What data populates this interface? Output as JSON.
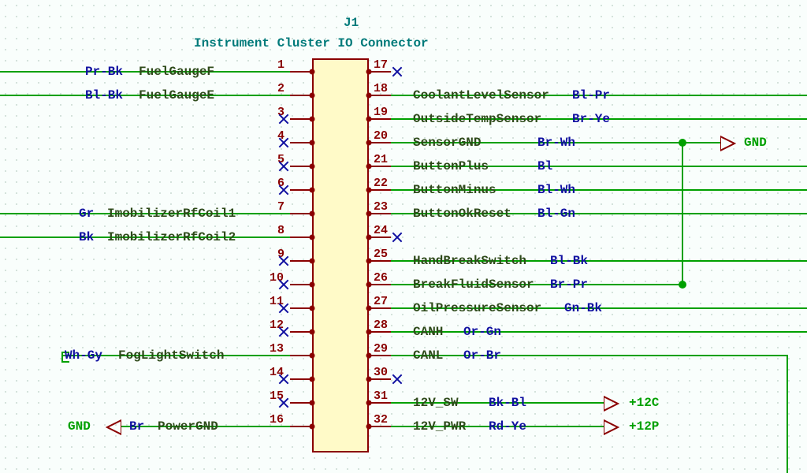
{
  "refdes": "J1",
  "title": "Instrument Cluster IO Connector",
  "power_labels": {
    "gnd_right": "GND",
    "gnd_left": "GND",
    "p12c": "+12C",
    "p12p": "+12P"
  },
  "left_pins": [
    {
      "num": "1",
      "net": "FuelGaugeF",
      "color": "Pr-Bk",
      "nc": false
    },
    {
      "num": "2",
      "net": "FuelGaugeE",
      "color": "Bl-Bk",
      "nc": false
    },
    {
      "num": "3",
      "net": "",
      "color": "",
      "nc": true
    },
    {
      "num": "4",
      "net": "",
      "color": "",
      "nc": true
    },
    {
      "num": "5",
      "net": "",
      "color": "",
      "nc": true
    },
    {
      "num": "6",
      "net": "",
      "color": "",
      "nc": true
    },
    {
      "num": "7",
      "net": "ImobilizerRfCoil1",
      "color": "Gr",
      "nc": false
    },
    {
      "num": "8",
      "net": "ImobilizerRfCoil2",
      "color": "Bk",
      "nc": false
    },
    {
      "num": "9",
      "net": "",
      "color": "",
      "nc": true
    },
    {
      "num": "10",
      "net": "",
      "color": "",
      "nc": true
    },
    {
      "num": "11",
      "net": "",
      "color": "",
      "nc": true
    },
    {
      "num": "12",
      "net": "",
      "color": "",
      "nc": true
    },
    {
      "num": "13",
      "net": "FogLightSwitch",
      "color": "Wh-Gy",
      "nc": false
    },
    {
      "num": "14",
      "net": "",
      "color": "",
      "nc": true
    },
    {
      "num": "15",
      "net": "",
      "color": "",
      "nc": true
    },
    {
      "num": "16",
      "net": "PowerGND",
      "color": "Br",
      "nc": false
    }
  ],
  "right_pins": [
    {
      "num": "17",
      "net": "",
      "color": "",
      "nc": true
    },
    {
      "num": "18",
      "net": "CoolantLevelSensor",
      "color": "Bl-Pr",
      "nc": false
    },
    {
      "num": "19",
      "net": "OutsideTempSensor",
      "color": "Br-Ye",
      "nc": false
    },
    {
      "num": "20",
      "net": "SensorGND",
      "color": "Br-Wh",
      "nc": false
    },
    {
      "num": "21",
      "net": "ButtonPlus",
      "color": "Bl",
      "nc": false
    },
    {
      "num": "22",
      "net": "ButtonMinus",
      "color": "Bl-Wh",
      "nc": false
    },
    {
      "num": "23",
      "net": "ButtonOkReset",
      "color": "Bl-Gn",
      "nc": false
    },
    {
      "num": "24",
      "net": "",
      "color": "",
      "nc": true
    },
    {
      "num": "25",
      "net": "HandBreakSwitch",
      "color": "Bl-Bk",
      "nc": false
    },
    {
      "num": "26",
      "net": "BreakFluidSensor",
      "color": "Br-Pr",
      "nc": false
    },
    {
      "num": "27",
      "net": "OilPressureSensor",
      "color": "Gn-Bk",
      "nc": false
    },
    {
      "num": "28",
      "net": "CANH",
      "color": "Or-Gn",
      "nc": false
    },
    {
      "num": "29",
      "net": "CANL",
      "color": "Or-Br",
      "nc": false
    },
    {
      "num": "30",
      "net": "",
      "color": "",
      "nc": true
    },
    {
      "num": "31",
      "net": "12V_SW",
      "color": "Bk-Bl",
      "nc": false
    },
    {
      "num": "32",
      "net": "12V_PWR",
      "color": "Rd-Ye",
      "nc": false
    }
  ]
}
